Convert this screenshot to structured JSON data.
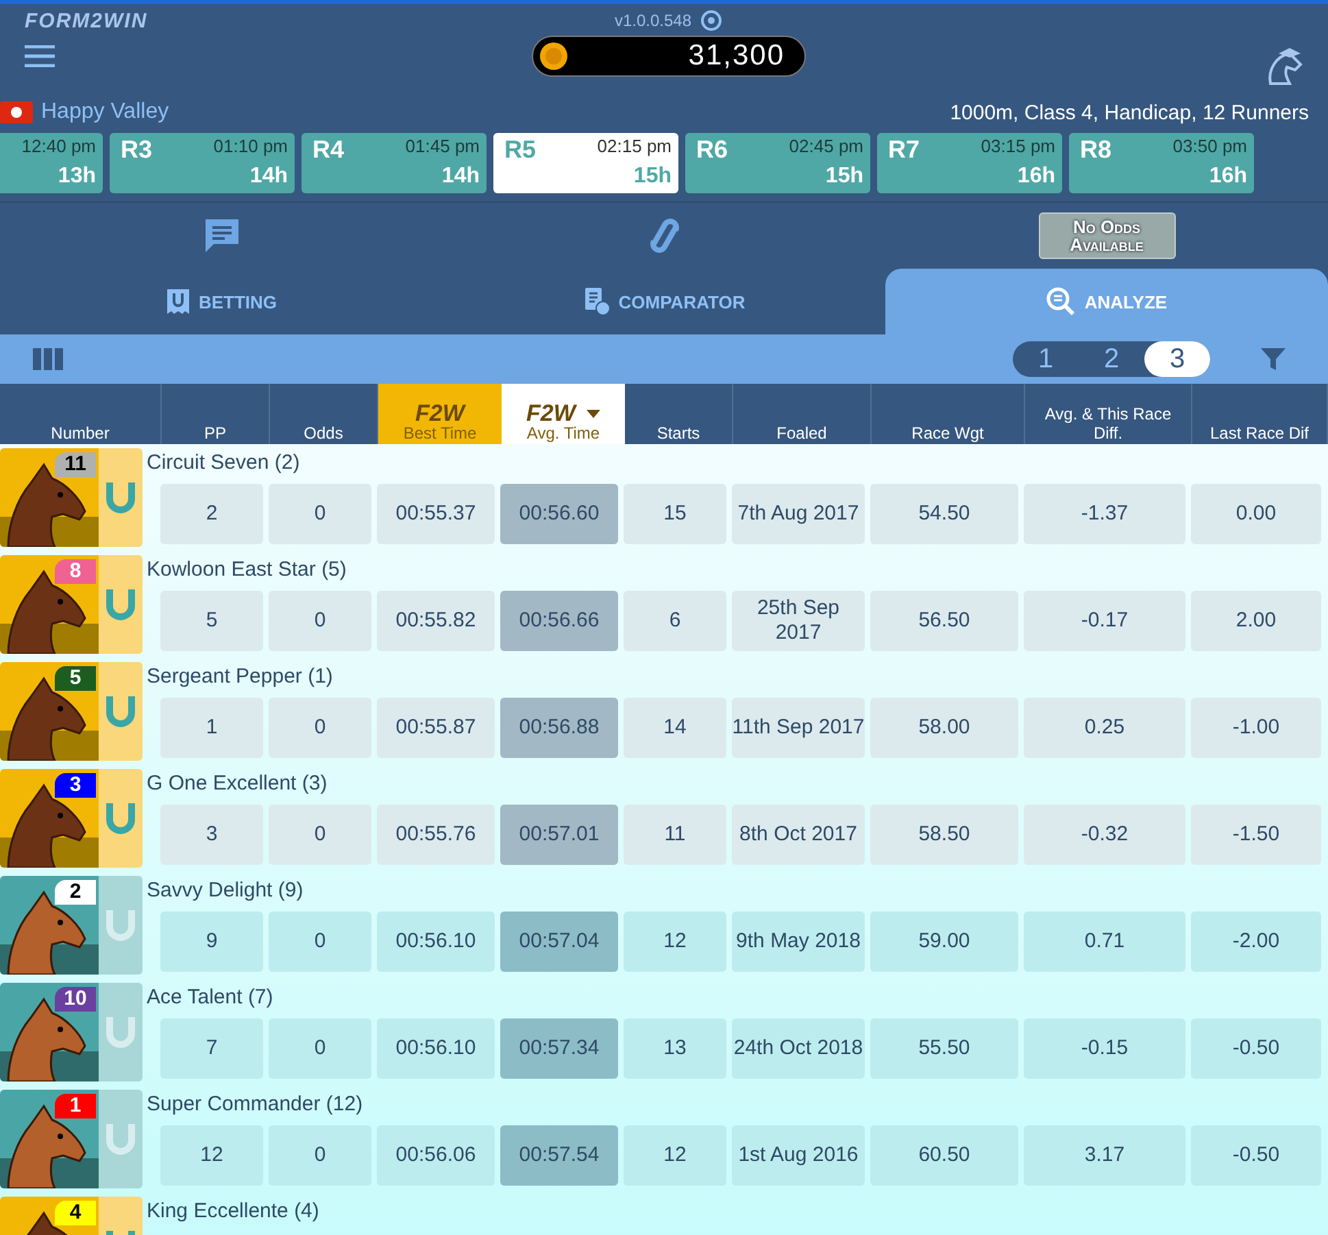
{
  "header": {
    "logo": "FORM2WIN",
    "version": "v1.0.0.548",
    "balance": "31,300"
  },
  "meeting": {
    "venue": "Happy Valley",
    "race_info": "1000m, Class 4, Handicap, 12 Runners"
  },
  "races": [
    {
      "time": "12:40 pm",
      "countdown": "13h",
      "selected": false
    },
    {
      "label": "R3",
      "time": "01:10 pm",
      "countdown": "14h",
      "selected": false
    },
    {
      "label": "R4",
      "time": "01:45 pm",
      "countdown": "14h",
      "selected": false
    },
    {
      "label": "R5",
      "time": "02:15 pm",
      "countdown": "15h",
      "selected": true
    },
    {
      "label": "R6",
      "time": "02:45 pm",
      "countdown": "15h",
      "selected": false
    },
    {
      "label": "R7",
      "time": "03:15 pm",
      "countdown": "16h",
      "selected": false
    },
    {
      "label": "R8",
      "time": "03:50 pm",
      "countdown": "16h",
      "selected": false
    }
  ],
  "odds_button": "No Odds Available",
  "tabs": [
    {
      "label": "BETTING",
      "kind": "betting",
      "selected": false
    },
    {
      "label": "COMPARATOR",
      "kind": "comparator",
      "selected": false
    },
    {
      "label": "ANALYZE",
      "kind": "analyze",
      "selected": true
    }
  ],
  "pages": [
    {
      "label": "1",
      "selected": false
    },
    {
      "label": "2",
      "selected": false
    },
    {
      "label": "3",
      "selected": true
    }
  ],
  "columns": [
    {
      "label": "Number",
      "kind": "plain"
    },
    {
      "label": "PP",
      "kind": "plain"
    },
    {
      "label": "Odds",
      "kind": "plain"
    },
    {
      "label": "Best Time",
      "kind": "f2w",
      "badge": "F2W",
      "selected": false
    },
    {
      "label": "Avg. Time",
      "kind": "f2w",
      "badge": "F2W",
      "selected": true
    },
    {
      "label": "Starts",
      "kind": "plain"
    },
    {
      "label": "Foaled",
      "kind": "plain"
    },
    {
      "label": "Race Wgt",
      "kind": "plain"
    },
    {
      "label": "Avg. & This Race Diff.",
      "kind": "plain"
    },
    {
      "label": "Last Race Dif",
      "kind": "plain"
    }
  ],
  "runners": [
    {
      "number": "11",
      "color": "#b0b0b0",
      "name": "Circuit Seven (2)",
      "highlighted": true,
      "cells": [
        "2",
        "0",
        "00:55.37",
        "00:56.60",
        "15",
        "7th Aug 2017",
        "54.50",
        "-1.37",
        "0.00"
      ]
    },
    {
      "number": "8",
      "color": "#f06292",
      "name": "Kowloon East Star (5)",
      "highlighted": true,
      "cells": [
        "5",
        "0",
        "00:55.82",
        "00:56.66",
        "6",
        "25th Sep 2017",
        "56.50",
        "-0.17",
        "2.00"
      ]
    },
    {
      "number": "5",
      "color": "#1b5e20",
      "name": "Sergeant Pepper (1)",
      "highlighted": true,
      "cells": [
        "1",
        "0",
        "00:55.87",
        "00:56.88",
        "14",
        "11th Sep 2017",
        "58.00",
        "0.25",
        "-1.00"
      ]
    },
    {
      "number": "3",
      "color": "#0000ff",
      "name": "G One Excellent (3)",
      "highlighted": true,
      "cells": [
        "3",
        "0",
        "00:55.76",
        "00:57.01",
        "11",
        "8th Oct 2017",
        "58.50",
        "-0.32",
        "-1.50"
      ]
    },
    {
      "number": "2",
      "color": "#ffffff",
      "name": "Savvy Delight (9)",
      "highlighted": false,
      "cells": [
        "9",
        "0",
        "00:56.10",
        "00:57.04",
        "12",
        "9th May 2018",
        "59.00",
        "0.71",
        "-2.00"
      ]
    },
    {
      "number": "10",
      "color": "#6a3fa0",
      "name": "Ace Talent (7)",
      "highlighted": false,
      "cells": [
        "7",
        "0",
        "00:56.10",
        "00:57.34",
        "13",
        "24th Oct 2018",
        "55.50",
        "-0.15",
        "-0.50"
      ]
    },
    {
      "number": "1",
      "color": "#ff0000",
      "name": "Super Commander (12)",
      "highlighted": false,
      "cells": [
        "12",
        "0",
        "00:56.06",
        "00:57.54",
        "12",
        "1st Aug 2016",
        "60.50",
        "3.17",
        "-0.50"
      ]
    },
    {
      "number": "4",
      "color": "#ffff00",
      "name": "King Eccellente (4)",
      "highlighted": true
    }
  ]
}
